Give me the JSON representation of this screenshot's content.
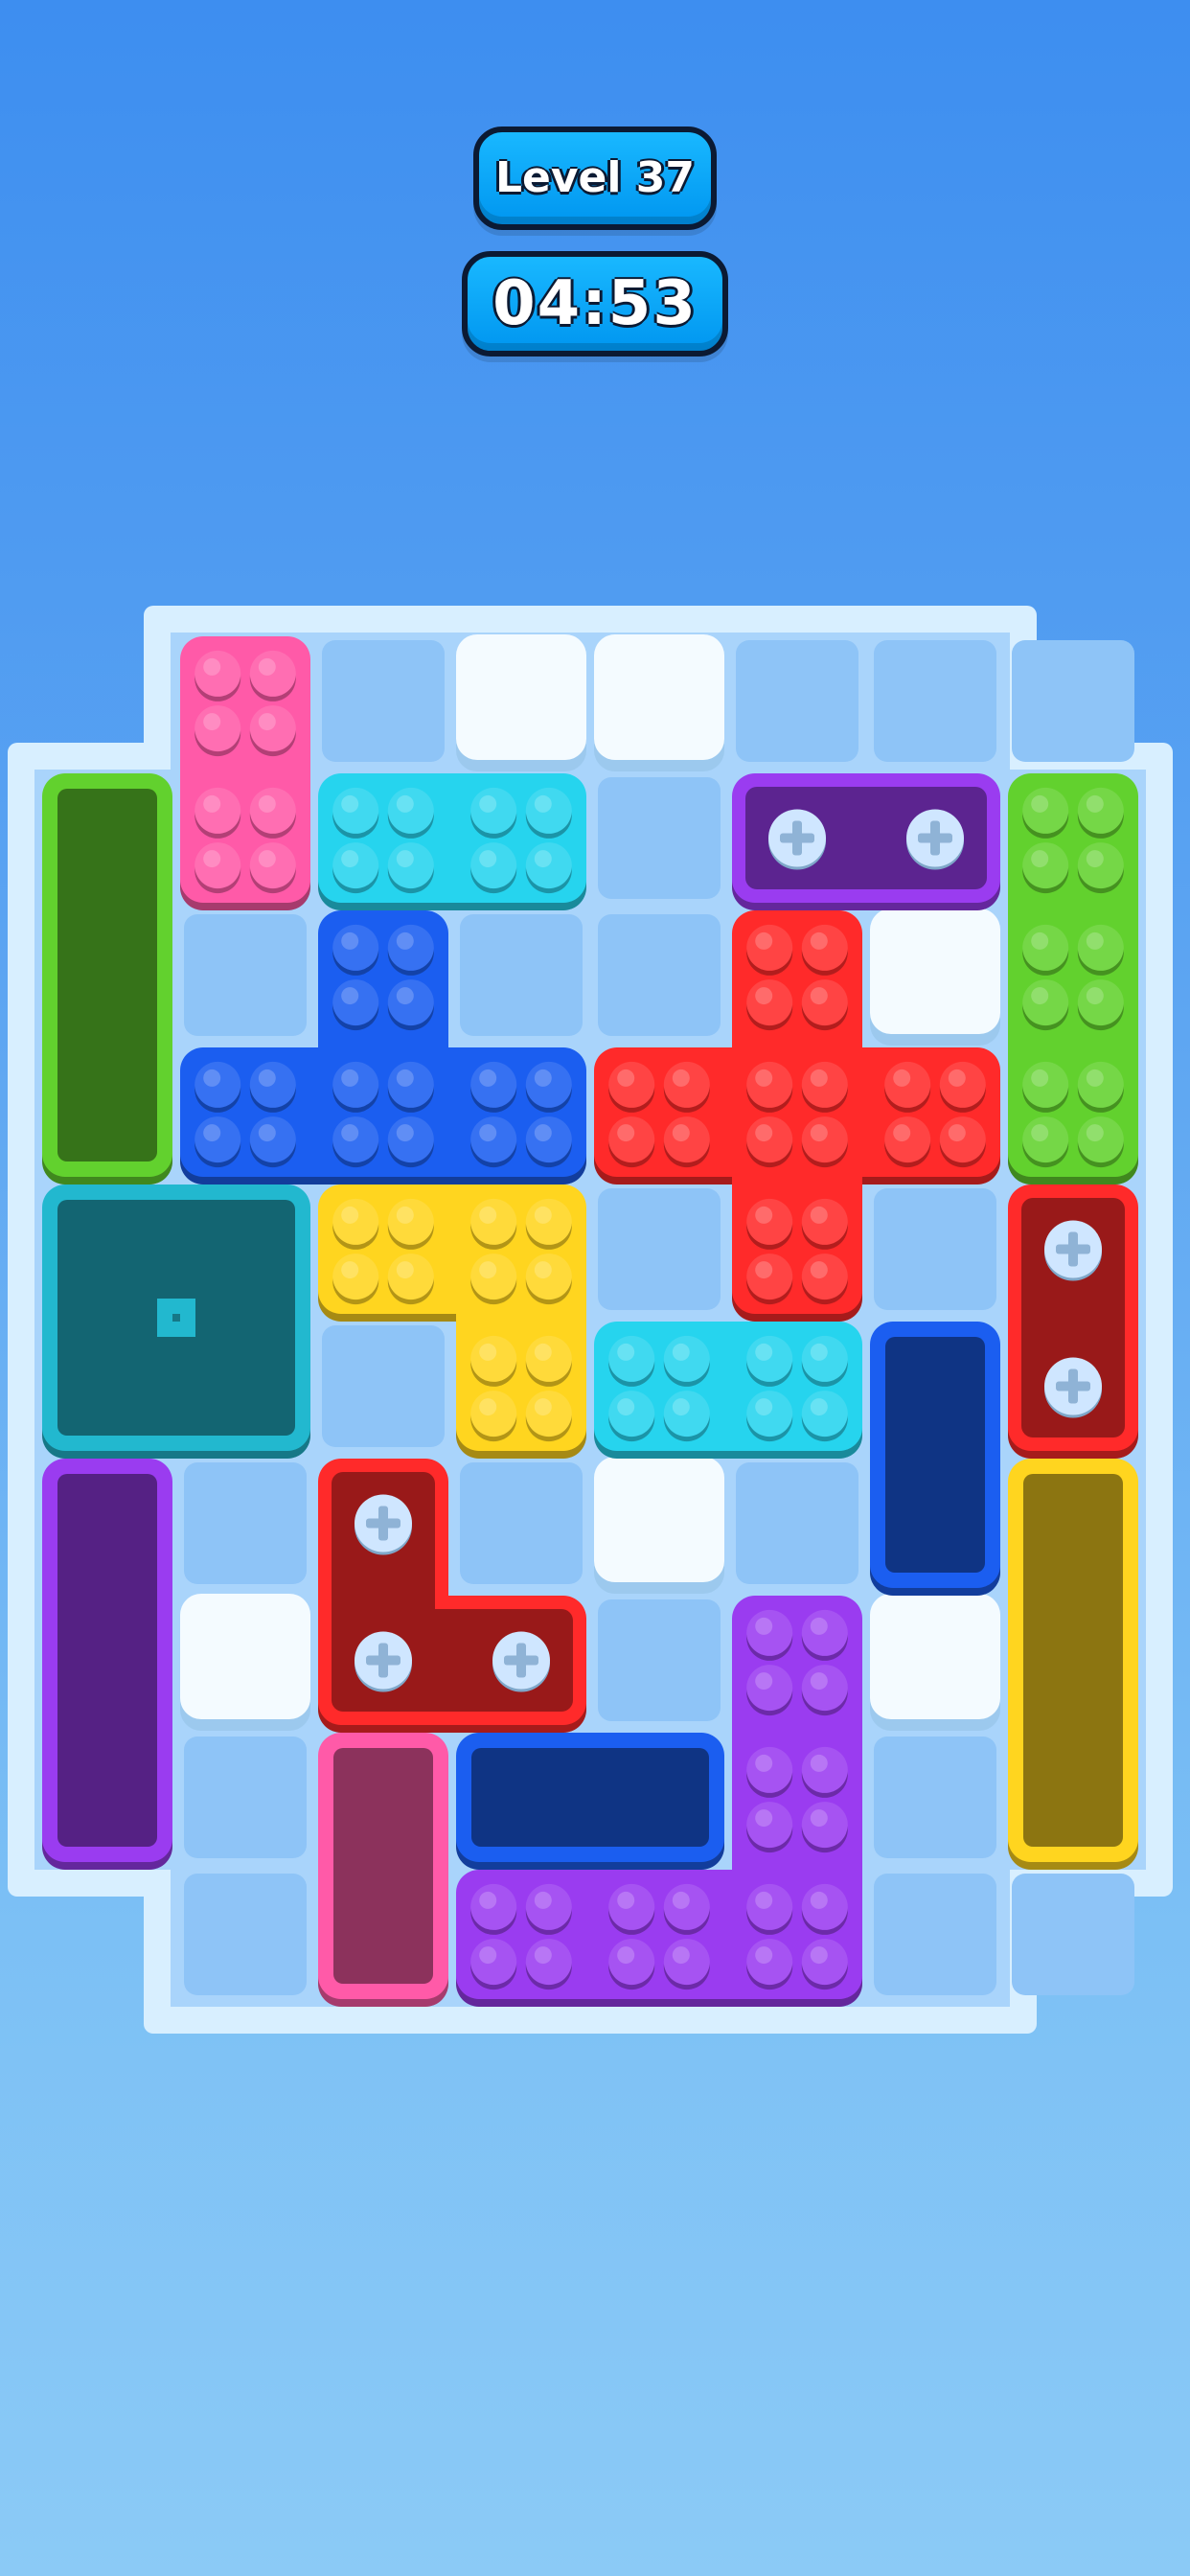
{
  "hud": {
    "level_label": "Level 37",
    "timer": "04:53"
  },
  "colors": {
    "board_frame": "#d8efff",
    "board_floor": "#a9d4fb",
    "cell": "#8ec4f7",
    "pink": "#ff5aa8",
    "cyan": "#26d4ee",
    "blue": "#1b5ef0",
    "red": "#ff2a2a",
    "yellow": "#ffd51f",
    "green": "#62d12e",
    "purple": "#9a3cf0",
    "teal": "#22b8cf",
    "screw": "#cfe6ff"
  },
  "board": {
    "columns": 8,
    "rows": 10,
    "obstacles": [
      {
        "name": "white-block-1",
        "col": 3,
        "row": 0
      },
      {
        "name": "white-block-2",
        "col": 4,
        "row": 0
      },
      {
        "name": "white-block-3",
        "col": 6,
        "row": 2
      },
      {
        "name": "white-block-4",
        "col": 4,
        "row": 6
      },
      {
        "name": "white-block-5",
        "col": 1,
        "row": 7
      },
      {
        "name": "white-block-6",
        "col": 6,
        "row": 7
      }
    ],
    "blocks": [
      {
        "name": "pink-brick-block",
        "color": "pink",
        "cells": [
          [
            1,
            0
          ],
          [
            1,
            1
          ]
        ]
      },
      {
        "name": "cyan-brick-block-top",
        "color": "cyan",
        "cells": [
          [
            2,
            1
          ],
          [
            3,
            1
          ]
        ]
      },
      {
        "name": "blue-t-brick-block",
        "color": "blue",
        "cells": [
          [
            2,
            2
          ],
          [
            1,
            3
          ],
          [
            2,
            3
          ],
          [
            3,
            3
          ]
        ]
      },
      {
        "name": "red-cross-brick-block",
        "color": "red",
        "cells": [
          [
            5,
            2
          ],
          [
            4,
            3
          ],
          [
            5,
            3
          ],
          [
            6,
            3
          ],
          [
            5,
            4
          ]
        ]
      },
      {
        "name": "green-brick-block",
        "color": "green",
        "cells": [
          [
            7,
            1
          ],
          [
            7,
            2
          ],
          [
            7,
            3
          ]
        ]
      },
      {
        "name": "yellow-l-brick-block",
        "color": "yellow",
        "cells": [
          [
            2,
            4
          ],
          [
            3,
            4
          ],
          [
            3,
            5
          ]
        ]
      },
      {
        "name": "cyan-brick-block-middle",
        "color": "cyan",
        "cells": [
          [
            4,
            5
          ],
          [
            5,
            5
          ]
        ]
      },
      {
        "name": "purple-l-brick-block",
        "color": "purple",
        "cells": [
          [
            5,
            7
          ],
          [
            5,
            8
          ],
          [
            3,
            9
          ],
          [
            4,
            9
          ],
          [
            5,
            9
          ]
        ]
      }
    ],
    "screw_blocks": [
      {
        "name": "purple-screw-block",
        "color": "purple",
        "cells": [
          [
            5,
            1
          ],
          [
            6,
            1
          ]
        ],
        "screws": [
          [
            5,
            1
          ],
          [
            6,
            1
          ]
        ]
      },
      {
        "name": "red-screw-block-right",
        "color": "red",
        "cells": [
          [
            7,
            4
          ],
          [
            7,
            5
          ]
        ],
        "screws": [
          [
            7,
            4
          ],
          [
            7,
            5
          ]
        ]
      },
      {
        "name": "red-l-screw-block",
        "color": "red",
        "cells": [
          [
            2,
            6
          ],
          [
            2,
            7
          ],
          [
            3,
            7
          ]
        ],
        "screws": [
          [
            2,
            6
          ],
          [
            2,
            7
          ],
          [
            3,
            7
          ]
        ]
      }
    ],
    "tanks": [
      {
        "name": "green-tank",
        "color": "green",
        "cells": [
          [
            0,
            1
          ],
          [
            0,
            2
          ],
          [
            0,
            3
          ]
        ]
      },
      {
        "name": "teal-tank",
        "color": "teal",
        "cells": [
          [
            0,
            4
          ],
          [
            1,
            4
          ],
          [
            0,
            5
          ],
          [
            1,
            5
          ]
        ]
      },
      {
        "name": "purple-tank",
        "color": "purple",
        "cells": [
          [
            0,
            6
          ],
          [
            0,
            7
          ],
          [
            0,
            8
          ]
        ]
      },
      {
        "name": "blue-tank-right",
        "color": "blue",
        "cells": [
          [
            6,
            5
          ],
          [
            6,
            6
          ]
        ]
      },
      {
        "name": "yellow-tank",
        "color": "yellow",
        "cells": [
          [
            7,
            6
          ],
          [
            7,
            7
          ],
          [
            7,
            8
          ]
        ]
      },
      {
        "name": "pink-tank",
        "color": "pink",
        "cells": [
          [
            2,
            8
          ],
          [
            2,
            9
          ]
        ]
      },
      {
        "name": "blue-tank-bottom",
        "color": "blue",
        "cells": [
          [
            3,
            8
          ],
          [
            4,
            8
          ]
        ]
      }
    ]
  }
}
